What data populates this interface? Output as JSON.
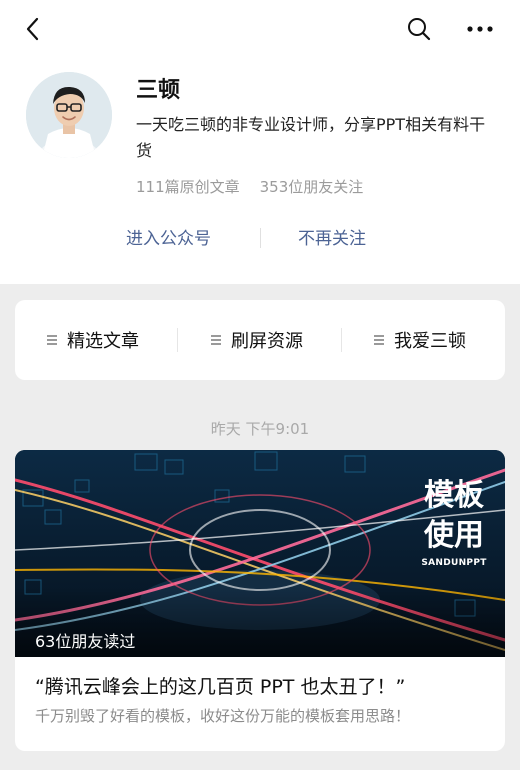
{
  "header": {
    "back_icon": "chevron-left-icon",
    "search_icon": "search-icon",
    "more_icon": "more-horizontal-icon"
  },
  "profile": {
    "name": "三顿",
    "description": "一天吃三顿的非专业设计师，分享PPT相关有料干货",
    "articles_count": "111篇原创文章",
    "followers_count": "353位朋友关注",
    "enter_label": "进入公众号",
    "unfollow_label": "不再关注"
  },
  "menu": {
    "items": [
      {
        "label": "精选文章",
        "icon": "menu-icon"
      },
      {
        "label": "刷屏资源",
        "icon": "menu-icon"
      },
      {
        "label": "我爱三顿",
        "icon": "menu-icon"
      }
    ]
  },
  "feed": {
    "timestamp": "昨天 下午9:01",
    "article": {
      "cover_title_line1": "模板",
      "cover_title_line2": "使用",
      "cover_brand": "SANDUNPPT",
      "reads": "63位朋友读过",
      "title": "“腾讯云峰会上的这几百页 PPT 也太丑了！”",
      "subtitle": "千万别毁了好看的模板，收好这份万能的模板套用思路！"
    }
  },
  "colors": {
    "link_blue": "#4c6394",
    "page_gray": "#ededed",
    "muted_text": "#9b9b9b"
  }
}
